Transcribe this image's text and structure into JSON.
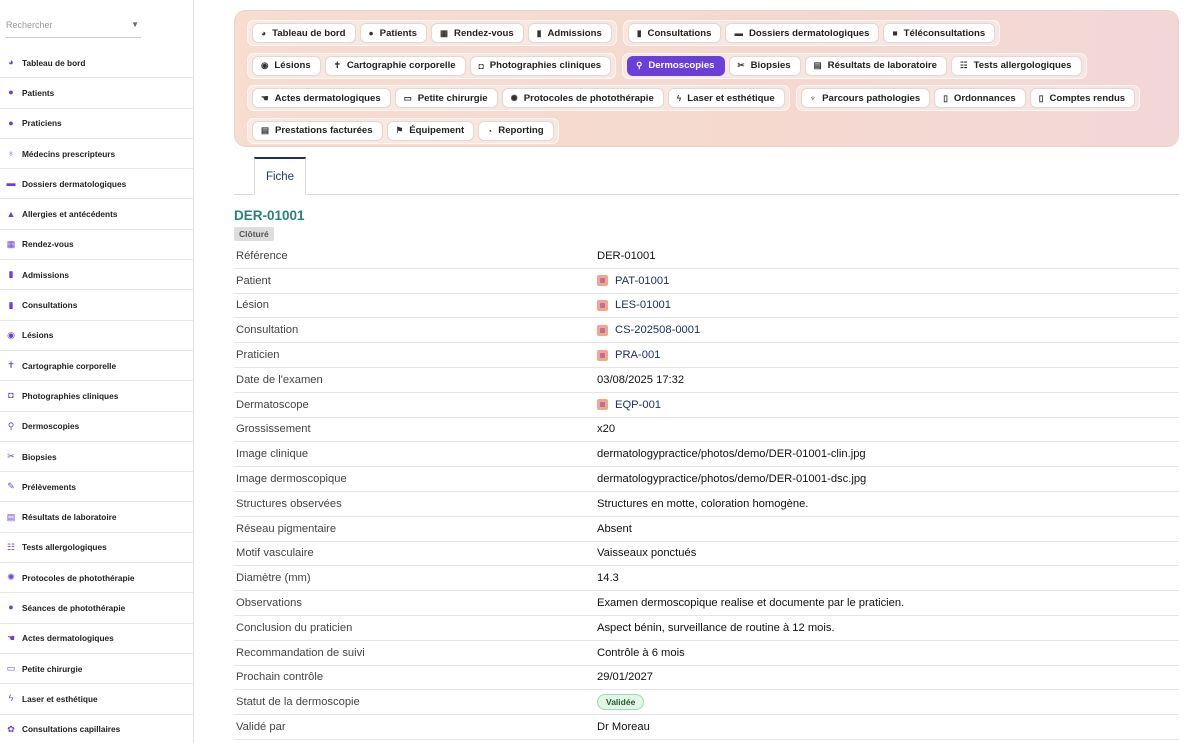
{
  "search": {
    "placeholder": "Rechercher"
  },
  "sidebar": {
    "items": [
      {
        "label": "Tableau de bord",
        "icon": "dashboard-icon",
        "glyph": "◕"
      },
      {
        "label": "Patients",
        "icon": "person-icon",
        "glyph": "●"
      },
      {
        "label": "Praticiens",
        "icon": "practitioner-icon",
        "glyph": "●"
      },
      {
        "label": "Médecins prescripteurs",
        "icon": "stethoscope-icon",
        "glyph": "♁"
      },
      {
        "label": "Dossiers dermatologiques",
        "icon": "folder-icon",
        "glyph": "▬"
      },
      {
        "label": "Allergies et antécédents",
        "icon": "warning-icon",
        "glyph": "▲"
      },
      {
        "label": "Rendez-vous",
        "icon": "calendar-icon",
        "glyph": "▦"
      },
      {
        "label": "Admissions",
        "icon": "clipboard-icon",
        "glyph": "▮"
      },
      {
        "label": "Consultations",
        "icon": "clipboard-icon",
        "glyph": "▮"
      },
      {
        "label": "Lésions",
        "icon": "circle-dot-icon",
        "glyph": "◉"
      },
      {
        "label": "Cartographie corporelle",
        "icon": "body-icon",
        "glyph": "✝"
      },
      {
        "label": "Photographies cliniques",
        "icon": "camera-icon",
        "glyph": "◘"
      },
      {
        "label": "Dermoscopies",
        "icon": "magnifier-icon",
        "glyph": "⚲"
      },
      {
        "label": "Biopsies",
        "icon": "scissors-icon",
        "glyph": "✂"
      },
      {
        "label": "Prélèvements",
        "icon": "syringe-icon",
        "glyph": "✎"
      },
      {
        "label": "Résultats de laboratoire",
        "icon": "report-icon",
        "glyph": "▤"
      },
      {
        "label": "Tests allergologiques",
        "icon": "test-strip-icon",
        "glyph": "☷"
      },
      {
        "label": "Protocoles de photothérapie",
        "icon": "sun-icon",
        "glyph": "✺"
      },
      {
        "label": "Séances de photothérapie",
        "icon": "bulb-icon",
        "glyph": "●"
      },
      {
        "label": "Actes dermatologiques",
        "icon": "hand-icon",
        "glyph": "☚"
      },
      {
        "label": "Petite chirurgie",
        "icon": "bed-icon",
        "glyph": "▭"
      },
      {
        "label": "Laser et esthétique",
        "icon": "bolt-icon",
        "glyph": "ϟ"
      },
      {
        "label": "Consultations capillaires",
        "icon": "spa-icon",
        "glyph": "✿"
      }
    ]
  },
  "nav": {
    "rows": [
      [
        [
          {
            "label": "Tableau de bord",
            "icon": "dashboard-icon",
            "glyph": "◕"
          },
          {
            "label": "Patients",
            "icon": "person-icon",
            "glyph": "●"
          },
          {
            "label": "Rendez-vous",
            "icon": "calendar-icon",
            "glyph": "▦"
          },
          {
            "label": "Admissions",
            "icon": "clipboard-icon",
            "glyph": "▮"
          }
        ],
        [
          {
            "label": "Consultations",
            "icon": "clipboard-icon",
            "glyph": "▮"
          },
          {
            "label": "Dossiers dermatologiques",
            "icon": "folder-icon",
            "glyph": "▬"
          },
          {
            "label": "Téléconsultations",
            "icon": "video-icon",
            "glyph": "■"
          }
        ]
      ],
      [
        [
          {
            "label": "Lésions",
            "icon": "circle-dot-icon",
            "glyph": "◉"
          },
          {
            "label": "Cartographie corporelle",
            "icon": "body-icon",
            "glyph": "✝"
          },
          {
            "label": "Photographies cliniques",
            "icon": "camera-icon",
            "glyph": "◘"
          }
        ],
        [
          {
            "label": "Dermoscopies",
            "icon": "magnifier-icon",
            "glyph": "⚲",
            "active": true
          },
          {
            "label": "Biopsies",
            "icon": "scissors-icon",
            "glyph": "✂"
          },
          {
            "label": "Résultats de laboratoire",
            "icon": "report-icon",
            "glyph": "▤"
          },
          {
            "label": "Tests allergologiques",
            "icon": "test-strip-icon",
            "glyph": "☷"
          }
        ]
      ],
      [
        [
          {
            "label": "Actes dermatologiques",
            "icon": "hand-icon",
            "glyph": "☚"
          },
          {
            "label": "Petite chirurgie",
            "icon": "bed-icon",
            "glyph": "▭"
          },
          {
            "label": "Protocoles de photothérapie",
            "icon": "sun-icon",
            "glyph": "✺"
          },
          {
            "label": "Laser et esthétique",
            "icon": "bolt-icon",
            "glyph": "ϟ"
          }
        ],
        [
          {
            "label": "Parcours pathologies",
            "icon": "route-icon",
            "glyph": "♆"
          },
          {
            "label": "Ordonnances",
            "icon": "document-icon",
            "glyph": "▯"
          },
          {
            "label": "Comptes rendus",
            "icon": "document-icon",
            "glyph": "▯"
          }
        ]
      ],
      [
        [
          {
            "label": "Prestations facturées",
            "icon": "invoice-icon",
            "glyph": "▤"
          },
          {
            "label": "Équipement",
            "icon": "equipment-icon",
            "glyph": "⚑"
          },
          {
            "label": "Reporting",
            "icon": "pie-chart-icon",
            "glyph": "◔"
          }
        ]
      ]
    ]
  },
  "tabs": {
    "fiche": "Fiche"
  },
  "record": {
    "title": "DER-01001",
    "closed_badge": "Clôturé",
    "fields": [
      {
        "label": "Référence",
        "value": "DER-01001"
      },
      {
        "label": "Patient",
        "value": "PAT-01001",
        "link": true
      },
      {
        "label": "Lésion",
        "value": "LES-01001",
        "link": true
      },
      {
        "label": "Consultation",
        "value": "CS-202508-0001",
        "link": true
      },
      {
        "label": "Praticien",
        "value": "PRA-001",
        "link": true
      },
      {
        "label": "Date de l'examen",
        "value": "03/08/2025 17:32"
      },
      {
        "label": "Dermatoscope",
        "value": "EQP-001",
        "link": true
      },
      {
        "label": "Grossissement",
        "value": "x20"
      },
      {
        "label": "Image clinique",
        "value": "dermatologypractice/photos/demo/DER-01001-clin.jpg"
      },
      {
        "label": "Image dermoscopique",
        "value": "dermatologypractice/photos/demo/DER-01001-dsc.jpg"
      },
      {
        "label": "Structures observées",
        "value": "Structures en motte, coloration homogène."
      },
      {
        "label": "Réseau pigmentaire",
        "value": "Absent"
      },
      {
        "label": "Motif vasculaire",
        "value": "Vaisseaux ponctués"
      },
      {
        "label": "Diamètre (mm)",
        "value": "14.3"
      },
      {
        "label": "Observations",
        "value": "Examen dermoscopique realise et documente par le praticien."
      },
      {
        "label": "Conclusion du praticien",
        "value": "Aspect bénin, surveillance de routine à 12 mois."
      },
      {
        "label": "Recommandation de suivi",
        "value": "Contrôle à 6 mois"
      },
      {
        "label": "Prochain contrôle",
        "value": "29/01/2027"
      },
      {
        "label": "Statut de la dermoscopie",
        "value": "Validée",
        "badge": true
      },
      {
        "label": "Validé par",
        "value": "Dr Moreau"
      }
    ]
  },
  "colors": {
    "accent": "#6a3fd9",
    "title": "#2a8080",
    "link": "#1b2f6b"
  }
}
